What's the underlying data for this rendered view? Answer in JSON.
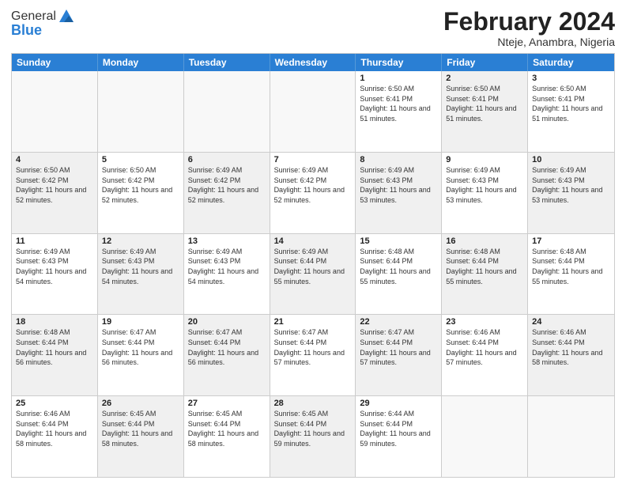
{
  "header": {
    "logo_general": "General",
    "logo_blue": "Blue",
    "month_title": "February 2024",
    "subtitle": "Nteje, Anambra, Nigeria"
  },
  "calendar": {
    "days_of_week": [
      "Sunday",
      "Monday",
      "Tuesday",
      "Wednesday",
      "Thursday",
      "Friday",
      "Saturday"
    ],
    "rows": [
      [
        {
          "day": "",
          "info": "",
          "empty": true
        },
        {
          "day": "",
          "info": "",
          "empty": true
        },
        {
          "day": "",
          "info": "",
          "empty": true
        },
        {
          "day": "",
          "info": "",
          "empty": true
        },
        {
          "day": "1",
          "info": "Sunrise: 6:50 AM\nSunset: 6:41 PM\nDaylight: 11 hours and 51 minutes."
        },
        {
          "day": "2",
          "info": "Sunrise: 6:50 AM\nSunset: 6:41 PM\nDaylight: 11 hours and 51 minutes.",
          "shaded": true
        },
        {
          "day": "3",
          "info": "Sunrise: 6:50 AM\nSunset: 6:41 PM\nDaylight: 11 hours and 51 minutes."
        }
      ],
      [
        {
          "day": "4",
          "info": "Sunrise: 6:50 AM\nSunset: 6:42 PM\nDaylight: 11 hours and 52 minutes.",
          "shaded": true
        },
        {
          "day": "5",
          "info": "Sunrise: 6:50 AM\nSunset: 6:42 PM\nDaylight: 11 hours and 52 minutes."
        },
        {
          "day": "6",
          "info": "Sunrise: 6:49 AM\nSunset: 6:42 PM\nDaylight: 11 hours and 52 minutes.",
          "shaded": true
        },
        {
          "day": "7",
          "info": "Sunrise: 6:49 AM\nSunset: 6:42 PM\nDaylight: 11 hours and 52 minutes."
        },
        {
          "day": "8",
          "info": "Sunrise: 6:49 AM\nSunset: 6:43 PM\nDaylight: 11 hours and 53 minutes.",
          "shaded": true
        },
        {
          "day": "9",
          "info": "Sunrise: 6:49 AM\nSunset: 6:43 PM\nDaylight: 11 hours and 53 minutes."
        },
        {
          "day": "10",
          "info": "Sunrise: 6:49 AM\nSunset: 6:43 PM\nDaylight: 11 hours and 53 minutes.",
          "shaded": true
        }
      ],
      [
        {
          "day": "11",
          "info": "Sunrise: 6:49 AM\nSunset: 6:43 PM\nDaylight: 11 hours and 54 minutes."
        },
        {
          "day": "12",
          "info": "Sunrise: 6:49 AM\nSunset: 6:43 PM\nDaylight: 11 hours and 54 minutes.",
          "shaded": true
        },
        {
          "day": "13",
          "info": "Sunrise: 6:49 AM\nSunset: 6:43 PM\nDaylight: 11 hours and 54 minutes."
        },
        {
          "day": "14",
          "info": "Sunrise: 6:49 AM\nSunset: 6:44 PM\nDaylight: 11 hours and 55 minutes.",
          "shaded": true
        },
        {
          "day": "15",
          "info": "Sunrise: 6:48 AM\nSunset: 6:44 PM\nDaylight: 11 hours and 55 minutes."
        },
        {
          "day": "16",
          "info": "Sunrise: 6:48 AM\nSunset: 6:44 PM\nDaylight: 11 hours and 55 minutes.",
          "shaded": true
        },
        {
          "day": "17",
          "info": "Sunrise: 6:48 AM\nSunset: 6:44 PM\nDaylight: 11 hours and 55 minutes."
        }
      ],
      [
        {
          "day": "18",
          "info": "Sunrise: 6:48 AM\nSunset: 6:44 PM\nDaylight: 11 hours and 56 minutes.",
          "shaded": true
        },
        {
          "day": "19",
          "info": "Sunrise: 6:47 AM\nSunset: 6:44 PM\nDaylight: 11 hours and 56 minutes."
        },
        {
          "day": "20",
          "info": "Sunrise: 6:47 AM\nSunset: 6:44 PM\nDaylight: 11 hours and 56 minutes.",
          "shaded": true
        },
        {
          "day": "21",
          "info": "Sunrise: 6:47 AM\nSunset: 6:44 PM\nDaylight: 11 hours and 57 minutes."
        },
        {
          "day": "22",
          "info": "Sunrise: 6:47 AM\nSunset: 6:44 PM\nDaylight: 11 hours and 57 minutes.",
          "shaded": true
        },
        {
          "day": "23",
          "info": "Sunrise: 6:46 AM\nSunset: 6:44 PM\nDaylight: 11 hours and 57 minutes."
        },
        {
          "day": "24",
          "info": "Sunrise: 6:46 AM\nSunset: 6:44 PM\nDaylight: 11 hours and 58 minutes.",
          "shaded": true
        }
      ],
      [
        {
          "day": "25",
          "info": "Sunrise: 6:46 AM\nSunset: 6:44 PM\nDaylight: 11 hours and 58 minutes."
        },
        {
          "day": "26",
          "info": "Sunrise: 6:45 AM\nSunset: 6:44 PM\nDaylight: 11 hours and 58 minutes.",
          "shaded": true
        },
        {
          "day": "27",
          "info": "Sunrise: 6:45 AM\nSunset: 6:44 PM\nDaylight: 11 hours and 58 minutes."
        },
        {
          "day": "28",
          "info": "Sunrise: 6:45 AM\nSunset: 6:44 PM\nDaylight: 11 hours and 59 minutes.",
          "shaded": true
        },
        {
          "day": "29",
          "info": "Sunrise: 6:44 AM\nSunset: 6:44 PM\nDaylight: 11 hours and 59 minutes."
        },
        {
          "day": "",
          "info": "",
          "empty": true
        },
        {
          "day": "",
          "info": "",
          "empty": true
        }
      ]
    ]
  }
}
